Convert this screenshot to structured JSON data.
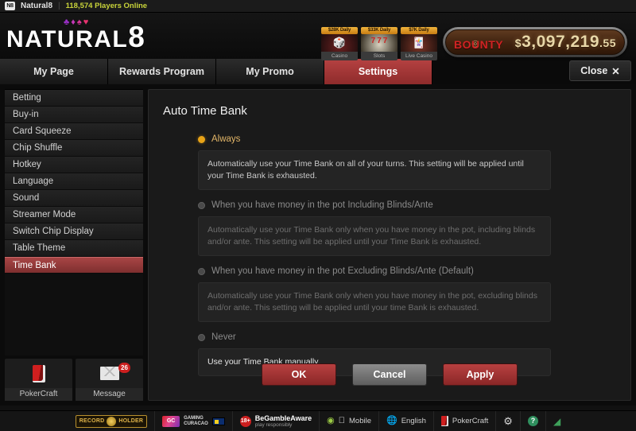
{
  "topbar": {
    "chip": "N8",
    "brand": "Natural8",
    "divider": "|",
    "players_online": "118,574 Players Online"
  },
  "header": {
    "logo_main": "NATURAL",
    "logo_eight": "8",
    "suits": [
      "♣",
      "♦",
      "♠",
      "♥"
    ],
    "promos": [
      {
        "badge": "$28K Daily",
        "label": "Casino",
        "glyph": "🎲"
      },
      {
        "badge": "$33K Daily",
        "label": "Slots",
        "glyph": "7 7 7"
      },
      {
        "badge": "$7K Daily",
        "label": "Live Casino",
        "glyph": "🃏"
      }
    ],
    "bounty": {
      "word": "BOUNTY",
      "dollar": "$",
      "amount": "3,097,219",
      "cents": ".55"
    }
  },
  "tabs": [
    {
      "label": "My Page",
      "active": false
    },
    {
      "label": "Rewards Program",
      "active": false
    },
    {
      "label": "My Promo",
      "active": false
    },
    {
      "label": "Settings",
      "active": true
    }
  ],
  "close_button": {
    "label": "Close",
    "icon": "✕"
  },
  "sidebar": {
    "items": [
      {
        "label": "Betting"
      },
      {
        "label": "Buy-in"
      },
      {
        "label": "Card Squeeze"
      },
      {
        "label": "Chip Shuffle"
      },
      {
        "label": "Hotkey"
      },
      {
        "label": "Language"
      },
      {
        "label": "Sound"
      },
      {
        "label": "Streamer Mode"
      },
      {
        "label": "Switch Chip Display"
      },
      {
        "label": "Table Theme"
      },
      {
        "label": "Time Bank"
      }
    ],
    "active_index": 10,
    "tiles": [
      {
        "label": "PokerCraft",
        "badge": ""
      },
      {
        "label": "Message",
        "badge": "26"
      }
    ]
  },
  "panel": {
    "title": "Auto Time Bank",
    "options": [
      {
        "label": "Always",
        "selected": true,
        "description": "Automatically use your Time Bank on all of your turns. This setting will be applied until your Time Bank is exhausted."
      },
      {
        "label": "When you have money in the pot Including Blinds/Ante",
        "selected": false,
        "description": "Automatically use your Time Bank only when you have money in the pot, including blinds and/or ante. This setting will be applied until your Time Bank is exhausted."
      },
      {
        "label": "When you have money in the pot Excluding Blinds/Ante (Default)",
        "selected": false,
        "description": "Automatically use your Time Bank only when you have money in the pot, excluding blinds and/or ante. This setting will be applied until your time Bank is exhausted."
      },
      {
        "label": "Never",
        "selected": false,
        "description": "Use your Time Bank manually."
      }
    ],
    "buttons": {
      "ok": "OK",
      "cancel": "Cancel",
      "apply": "Apply"
    }
  },
  "footer": {
    "record_holder": {
      "left": "RECORD",
      "right": "HOLDER"
    },
    "gaming_curacao": {
      "mark": "GC",
      "line1": "GAMING",
      "line2": "CURACAO"
    },
    "begambleaware": {
      "age": "18+",
      "line1": "BeGambleAware",
      "line2": "play responsibly"
    },
    "mobile": "Mobile",
    "language": "English",
    "pokercraft": "PokerCraft",
    "icons": {
      "gear": "⚙",
      "help": "?",
      "signal": "◢"
    }
  },
  "colors": {
    "accent_red": "#a84545",
    "radio_on": "#e8a317",
    "players_text": "#c9d43a",
    "bounty_gold": "#e8d7a8"
  }
}
